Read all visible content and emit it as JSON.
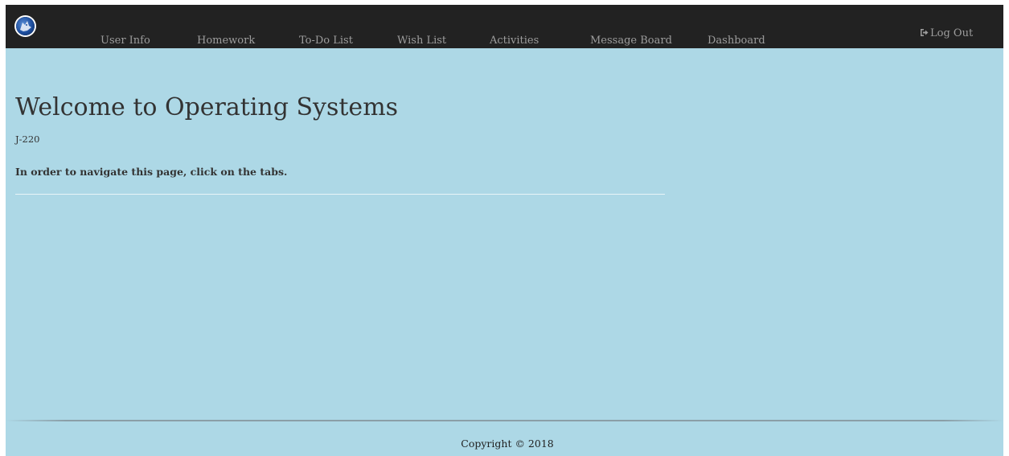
{
  "nav": {
    "logo_icon": "wolf-logo-icon",
    "items": [
      {
        "label": "User Info"
      },
      {
        "label": "Homework"
      },
      {
        "label": "To-Do List"
      },
      {
        "label": "Wish List"
      },
      {
        "label": "Activities"
      },
      {
        "label": "Message Board"
      },
      {
        "label": "Dashboard"
      }
    ],
    "logout": {
      "label": "Log Out",
      "icon": "log-out-icon"
    }
  },
  "main": {
    "title": "Welcome to Operating Systems",
    "room": "J-220",
    "instructions": "In order to navigate this page, click on the tabs."
  },
  "footer": {
    "copyright": "Copyright © 2018"
  },
  "colors": {
    "background": "#add8e6",
    "navbar": "#222222",
    "nav_text": "#9d9d9d",
    "body_text": "#333333"
  }
}
